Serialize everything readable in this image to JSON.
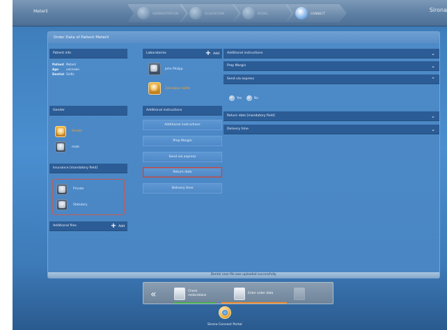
{
  "window": {
    "patient_name": "Meterli",
    "brand": "Sirona"
  },
  "wizard": {
    "steps": [
      {
        "label": "ADMINISTRATION",
        "state": "inactive"
      },
      {
        "label": "ACQUISITION",
        "state": "inactive"
      },
      {
        "label": "MODEL",
        "state": "inactive"
      },
      {
        "label": "CONNECT",
        "state": "active"
      }
    ]
  },
  "panel": {
    "title": "Order Data of Patient Meterli"
  },
  "patient_info": {
    "header": "Patient info",
    "rows": [
      {
        "key": "Patient",
        "value": "Meterli"
      },
      {
        "key": "Age",
        "value": "unknown"
      },
      {
        "key": "Dentist",
        "value": "Sirifiz"
      }
    ]
  },
  "gender": {
    "header": "Gender",
    "options": [
      {
        "label": "female",
        "selected": true
      },
      {
        "label": "male",
        "selected": false
      }
    ]
  },
  "insurance": {
    "header": "Insurance   [mandatory field]",
    "options": [
      {
        "label": "Private"
      },
      {
        "label": "Statutory"
      }
    ]
  },
  "additional_files": {
    "header": "Additional files",
    "add_label": "Add"
  },
  "laboratories": {
    "header": "Laboratories",
    "add_label": "Add",
    "items": [
      {
        "label": "John Philipp",
        "selected": false
      },
      {
        "label": "Zahnlabor Sirifiz",
        "selected": true
      }
    ]
  },
  "additional_instructions": {
    "header": "Additional instructions",
    "buttons": [
      {
        "label": "Additional instructions",
        "selected": false
      },
      {
        "label": "Prep Margin",
        "selected": false
      },
      {
        "label": "Send via express",
        "selected": false
      },
      {
        "label": "Return date",
        "selected": true
      },
      {
        "label": "Delivery time",
        "selected": false
      }
    ]
  },
  "right_sections": [
    {
      "label": "Additional instructions",
      "expanded": false
    },
    {
      "label": "Prep Margin",
      "expanded": false
    },
    {
      "label": "Send via express",
      "expanded": true
    },
    {
      "label": "Return date   [mandatory field]",
      "expanded": false
    },
    {
      "label": "Delivery time",
      "expanded": false
    }
  ],
  "express_options": {
    "yes_label": "Yes",
    "no_label": "No"
  },
  "status": {
    "message": "Dental case file was uploaded successfully."
  },
  "bottom_toolbar": {
    "back_icon": "double-chevron-left",
    "steps": [
      {
        "label_line1": "Check",
        "label_line2": "restorations",
        "state": "completed"
      },
      {
        "label_line1": "Enter order data",
        "label_line2": "",
        "state": "active"
      },
      {
        "label_line1": "",
        "label_line2": "",
        "state": "disabled"
      }
    ]
  },
  "footer": {
    "portal_label": "Sirona Connect Portal"
  },
  "colors": {
    "accent_orange": "#f5a533",
    "selection_red": "#c9473d",
    "header_blue": "#2c5c95",
    "panel_blue": "#4a86c4"
  }
}
